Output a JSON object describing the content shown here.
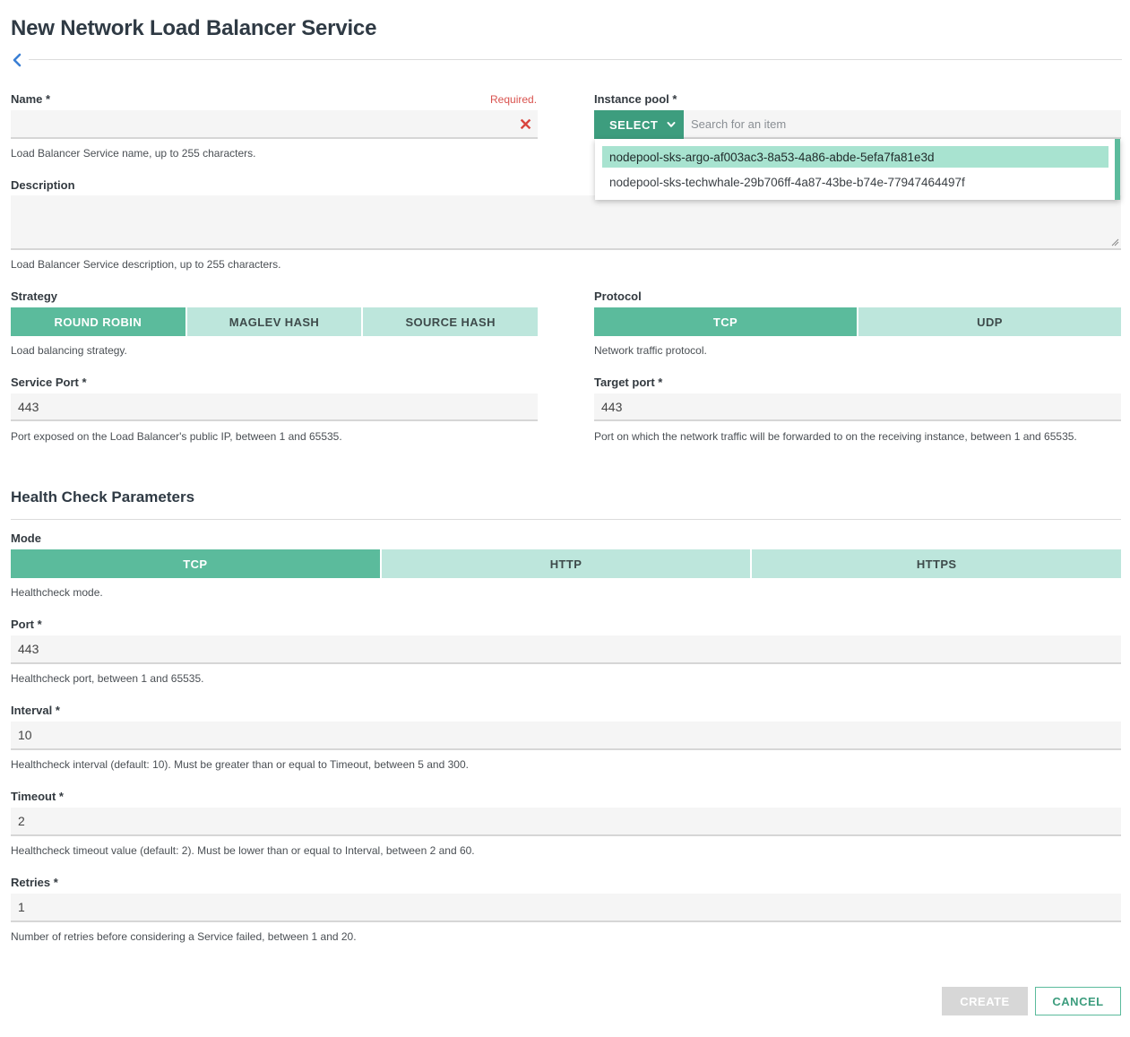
{
  "page": {
    "title": "New Network Load Balancer Service"
  },
  "name": {
    "label": "Name *",
    "error": "Required.",
    "value": "",
    "hint": "Load Balancer Service name, up to 255 characters."
  },
  "instance_pool": {
    "label": "Instance pool *",
    "select_label": "SELECT",
    "search_placeholder": "Search for an item",
    "options": [
      "nodepool-sks-argo-af003ac3-8a53-4a86-abde-5efa7fa81e3d",
      "nodepool-sks-techwhale-29b706ff-4a87-43be-b74e-77947464497f"
    ],
    "highlighted": 0
  },
  "description": {
    "label": "Description",
    "hint": "Load Balancer Service description, up to 255 characters."
  },
  "strategy": {
    "label": "Strategy",
    "options": [
      "ROUND ROBIN",
      "MAGLEV HASH",
      "SOURCE HASH"
    ],
    "selected": 0,
    "hint": "Load balancing strategy."
  },
  "protocol": {
    "label": "Protocol",
    "options": [
      "TCP",
      "UDP"
    ],
    "selected": 0,
    "hint": "Network traffic protocol."
  },
  "service_port": {
    "label": "Service Port *",
    "value": "443",
    "hint": "Port exposed on the Load Balancer's public IP, between 1 and 65535."
  },
  "target_port": {
    "label": "Target port *",
    "value": "443",
    "hint": "Port on which the network traffic will be forwarded to on the receiving instance, between 1 and 65535."
  },
  "health": {
    "title": "Health Check Parameters",
    "mode": {
      "label": "Mode",
      "options": [
        "TCP",
        "HTTP",
        "HTTPS"
      ],
      "selected": 0,
      "hint": "Healthcheck mode."
    },
    "port": {
      "label": "Port *",
      "value": "443",
      "hint": "Healthcheck port, between 1 and 65535."
    },
    "interval": {
      "label": "Interval *",
      "value": "10",
      "hint": "Healthcheck interval (default: 10). Must be greater than or equal to Timeout, between 5 and 300."
    },
    "timeout": {
      "label": "Timeout *",
      "value": "2",
      "hint": "Healthcheck timeout value (default: 2). Must be lower than or equal to Interval, between 2 and 60."
    },
    "retries": {
      "label": "Retries *",
      "value": "1",
      "hint": "Number of retries before considering a Service failed, between 1 and 20."
    }
  },
  "actions": {
    "create": "CREATE",
    "cancel": "CANCEL"
  },
  "colors": {
    "accent": "#5bbb9c",
    "accent_dark": "#3d9d7e",
    "accent_light": "#bde6dc",
    "error": "#d9534f"
  }
}
